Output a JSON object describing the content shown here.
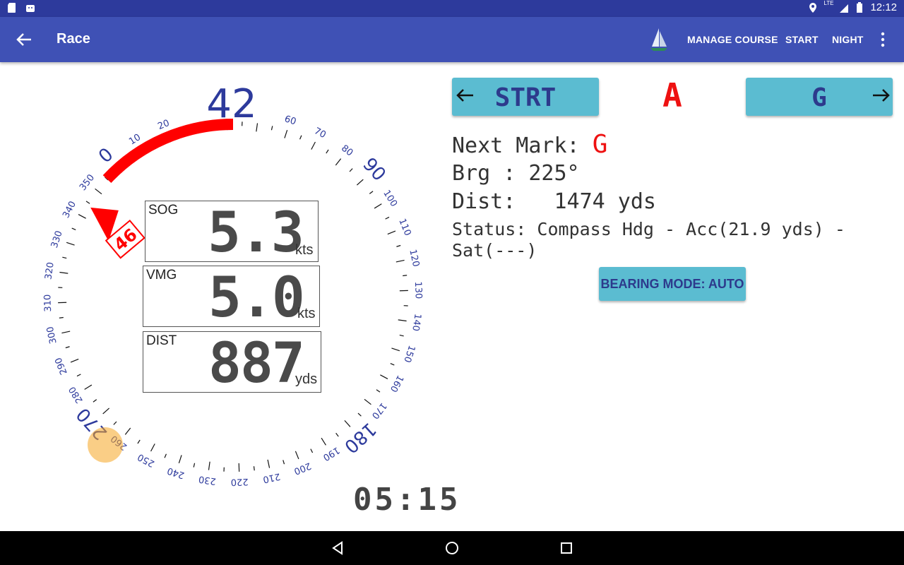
{
  "status_bar": {
    "time": "12:12",
    "network": "LTE"
  },
  "app_bar": {
    "title": "Race",
    "actions": [
      "MANAGE COURSE",
      "START",
      "NIGHT"
    ]
  },
  "compass": {
    "heading": "42",
    "bearing_marker": "46",
    "cardinal_labels": [
      "0",
      "90",
      "180",
      "270"
    ],
    "tick_labels": [
      "10",
      "20",
      "60",
      "70",
      "80",
      "100",
      "110",
      "120",
      "130",
      "140",
      "150",
      "160",
      "170",
      "190",
      "200",
      "210",
      "220",
      "230",
      "240",
      "250",
      "260",
      "280",
      "290",
      "300",
      "310",
      "320",
      "330",
      "340",
      "350"
    ]
  },
  "instruments": {
    "sog": {
      "label": "SOG",
      "value": "5.3",
      "unit": "kts"
    },
    "vmg": {
      "label": "VMG",
      "value": "5.0",
      "unit": "kts"
    },
    "dist": {
      "label": "DIST",
      "value": "887",
      "unit": "yds"
    }
  },
  "timer": "05:15",
  "course": {
    "prev_mark": "STRT",
    "current_mark": "A",
    "next_mark_button": "G"
  },
  "info": {
    "next_mark_label": "Next Mark:",
    "next_mark_value": "G",
    "bearing": "Brg : 225°",
    "distance": "Dist:   1474 yds",
    "status": "Status: Compass Hdg - Acc(21.9 yds) -",
    "status_cont": "Sat(---)"
  },
  "bearing_mode_button": "BEARING MODE: AUTO",
  "colors": {
    "app_bar": "#3f51b5",
    "status_bar": "#2d3a9c",
    "button": "#5bbcd1",
    "accent_red": "#ee1111",
    "compass_blue": "#2d3a9c"
  }
}
